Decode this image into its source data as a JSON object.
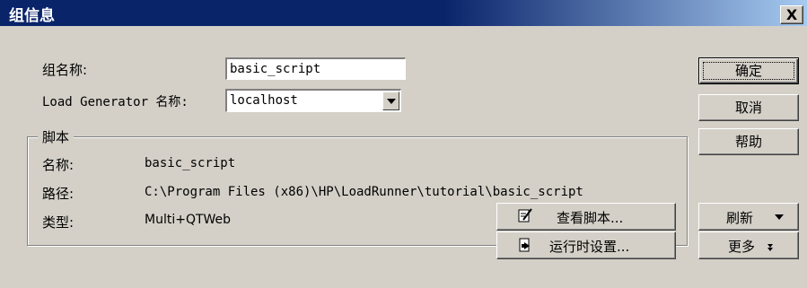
{
  "window": {
    "title": "组信息",
    "close_label": "X"
  },
  "form": {
    "group_name_label": "组名称:",
    "group_name_value": "basic_script",
    "load_generator_label": "Load Generator 名称:",
    "load_generator_value": "localhost"
  },
  "script_group": {
    "title": "脚本",
    "name_label": "名称:",
    "name_value": "basic_script",
    "path_label": "路径:",
    "path_value": "C:\\Program Files (x86)\\HP\\LoadRunner\\tutorial\\basic_script",
    "type_label": "类型:",
    "type_value": "Multi+QTWeb"
  },
  "buttons": {
    "ok": "确定",
    "cancel": "取消",
    "help": "帮助",
    "view_script": "查看脚本...",
    "runtime_settings": "运行时设置...",
    "refresh": "刷新",
    "more": "更多"
  },
  "icons": {
    "view_script": "notepad-pencil-icon",
    "runtime_settings": "settings-page-icon"
  }
}
